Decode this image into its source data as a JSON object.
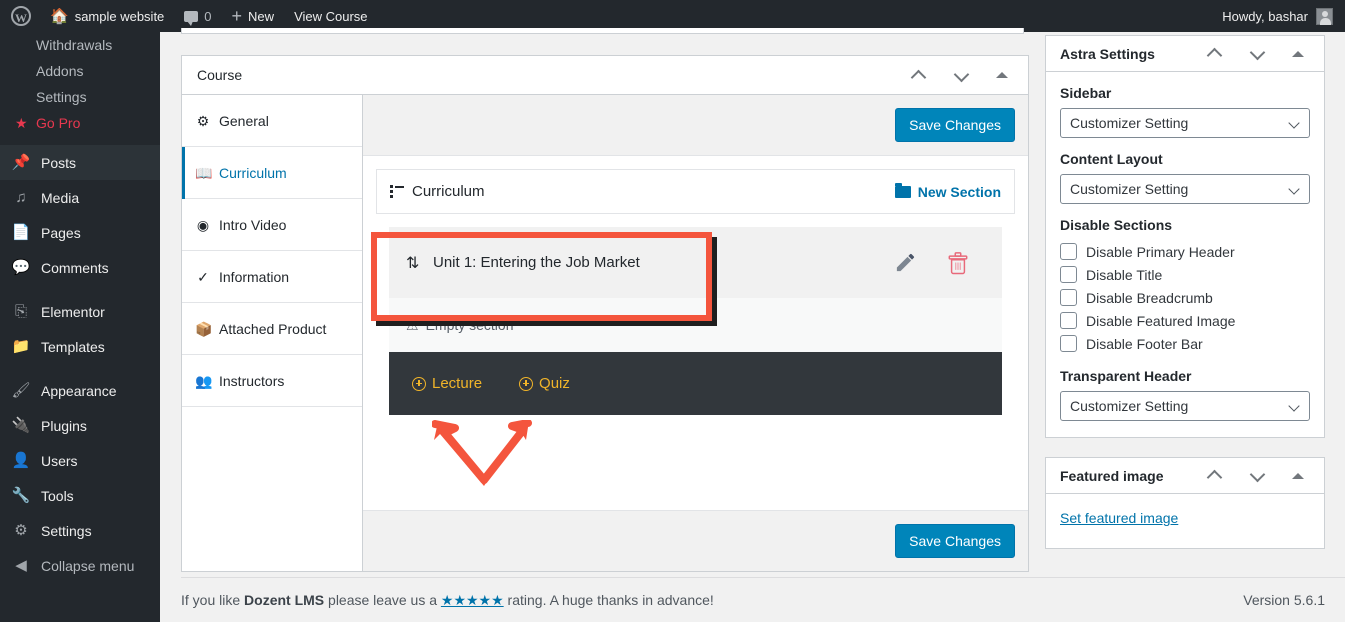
{
  "adminbar": {
    "logo_icon": "wordpress-logo-icon",
    "site_name": "sample website",
    "site_icon": "home-icon",
    "comments_icon": "comment-icon",
    "comments_count": "0",
    "new_icon": "plus-icon",
    "new_label": "New",
    "view_course_label": "View Course",
    "howdy": "Howdy, bashar",
    "avatar_icon": "avatar-icon"
  },
  "sidebar": {
    "submenu": [
      {
        "label": "Withdrawals",
        "icon": ""
      },
      {
        "label": "Addons",
        "icon": ""
      },
      {
        "label": "Settings",
        "icon": ""
      },
      {
        "label": "Go Pro",
        "icon": "star-icon",
        "color": "#e8384f"
      }
    ],
    "items": [
      {
        "label": "Posts",
        "icon": "pin-icon",
        "current": true
      },
      {
        "label": "Media",
        "icon": "media-icon",
        "current": false
      },
      {
        "label": "Pages",
        "icon": "pages-icon",
        "current": false
      },
      {
        "label": "Comments",
        "icon": "comment-icon",
        "current": false
      },
      {
        "label": "Elementor",
        "icon": "elementor-icon",
        "current": false
      },
      {
        "label": "Templates",
        "icon": "folder-icon",
        "current": false
      },
      {
        "label": "Appearance",
        "icon": "brush-icon",
        "current": false
      },
      {
        "label": "Plugins",
        "icon": "plug-icon",
        "current": false
      },
      {
        "label": "Users",
        "icon": "user-icon",
        "current": false
      },
      {
        "label": "Tools",
        "icon": "wrench-icon",
        "current": false
      },
      {
        "label": "Settings",
        "icon": "sliders-icon",
        "current": false
      },
      {
        "label": "Collapse menu",
        "icon": "collapse-icon",
        "current": false
      }
    ]
  },
  "course_box": {
    "title": "Course",
    "controls": {
      "up_icon": "chevron-up-icon",
      "down_icon": "chevron-down-icon",
      "toggle_icon": "triangle-up-icon"
    },
    "tabs": [
      {
        "label": "General",
        "icon": "gear-icon",
        "active": false
      },
      {
        "label": "Curriculum",
        "icon": "book-icon",
        "active": true
      },
      {
        "label": "Intro Video",
        "icon": "play-circle-icon",
        "active": false
      },
      {
        "label": "Information",
        "icon": "check-circle-icon",
        "active": false
      },
      {
        "label": "Attached Product",
        "icon": "product-icon",
        "active": false
      },
      {
        "label": "Instructors",
        "icon": "instructors-icon",
        "active": false
      }
    ],
    "save_top_label": "Save Changes",
    "save_bottom_label": "Save Changes",
    "curriculum": {
      "header_label": "Curriculum",
      "header_icon": "list-icon",
      "new_section_label": "New Section",
      "new_section_icon": "folder-icon",
      "section": {
        "sort_icon": "sort-updown-icon",
        "name": "Unit 1: Entering the Job Market",
        "edit_icon": "pencil-icon",
        "delete_icon": "trash-icon"
      },
      "empty_label": "Empty section",
      "empty_icon": "warning-icon",
      "add_buttons": [
        {
          "label": "Lecture",
          "icon": "plus-circle-icon"
        },
        {
          "label": "Quiz",
          "icon": "plus-circle-icon"
        }
      ]
    }
  },
  "astra": {
    "title": "Astra Settings",
    "controls": {
      "up_icon": "chevron-up-icon",
      "down_icon": "chevron-down-icon",
      "toggle_icon": "triangle-up-icon"
    },
    "sidebar_label": "Sidebar",
    "sidebar_value": "Customizer Setting",
    "content_layout_label": "Content Layout",
    "content_layout_value": "Customizer Setting",
    "disable_sections_label": "Disable Sections",
    "checkboxes": [
      {
        "label": "Disable Primary Header",
        "checked": false
      },
      {
        "label": "Disable Title",
        "checked": false
      },
      {
        "label": "Disable Breadcrumb",
        "checked": false
      },
      {
        "label": "Disable Featured Image",
        "checked": false
      },
      {
        "label": "Disable Footer Bar",
        "checked": false
      }
    ],
    "transparent_header_label": "Transparent Header",
    "transparent_header_value": "Customizer Setting"
  },
  "featured_image": {
    "title": "Featured image",
    "controls": {
      "up_icon": "chevron-up-icon",
      "down_icon": "chevron-down-icon",
      "toggle_icon": "triangle-up-icon"
    },
    "link_label": "Set featured image"
  },
  "footer": {
    "text_before": "If you like ",
    "plugin_name": "Dozent LMS",
    "text_middle": " please leave us a ",
    "stars": "★★★★★",
    "text_after": " rating. A huge thanks in advance!",
    "version": "Version 5.6.1"
  },
  "annotations": {
    "highlight_box_color": "#f4553d",
    "arrow_color": "#f4553d",
    "arrow_name": "double-arrow-pointing-to-lecture-and-quiz"
  }
}
